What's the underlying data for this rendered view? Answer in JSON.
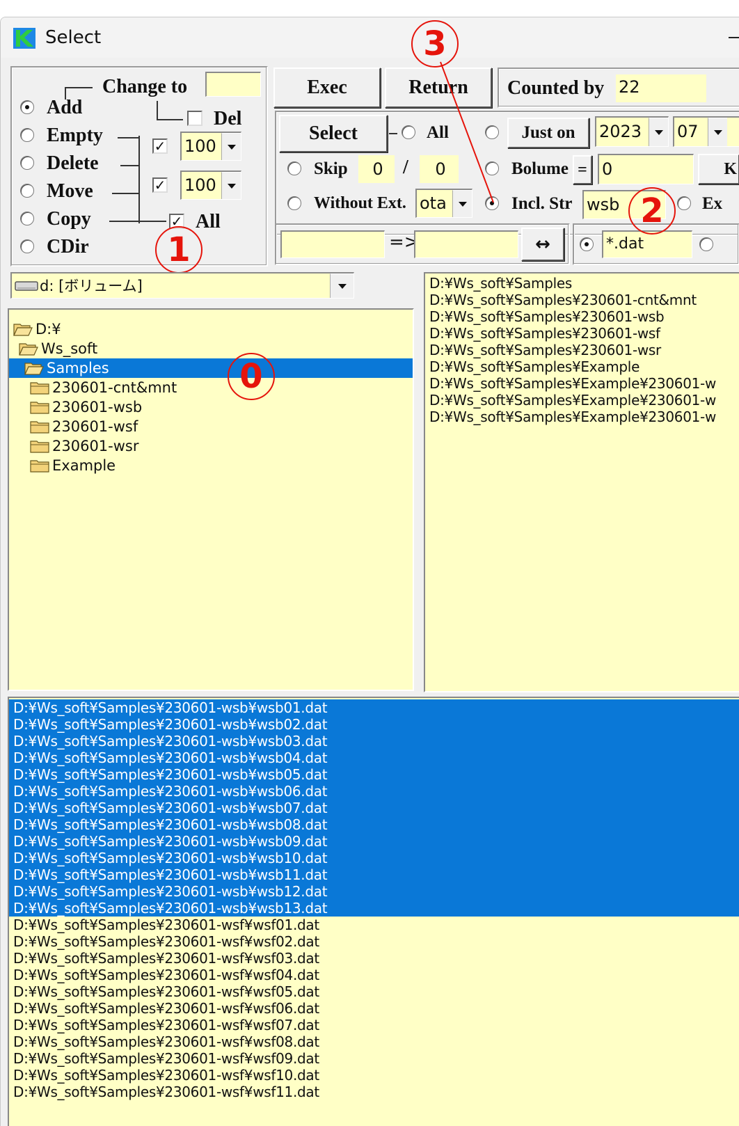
{
  "window": {
    "title": "Select"
  },
  "left_group": {
    "change_to_label": "Change to",
    "change_to_value": "",
    "del_label": "Del",
    "all_label": "All",
    "ops": [
      {
        "label": "Add",
        "selected": true
      },
      {
        "label": "Empty",
        "selected": false
      },
      {
        "label": "Delete",
        "selected": false
      },
      {
        "label": "Move",
        "selected": false
      },
      {
        "label": "Copy",
        "selected": false
      },
      {
        "label": "CDir",
        "selected": false
      }
    ],
    "combo1": "100",
    "combo2": "100"
  },
  "toolbar": {
    "exec_label": "Exec",
    "return_label": "Return",
    "counted_by_label": "Counted by",
    "counted_by_value": "22"
  },
  "select_group": {
    "select_label": "Select",
    "all_label": "All",
    "just_on_label": "Just on",
    "year": "2023",
    "month": "07",
    "skip_label": "Skip",
    "skip_a": "0",
    "skip_sep": "/",
    "skip_b": "0",
    "bolume_label": "Bolume",
    "bolume_op": "=",
    "bolume_value": "0",
    "bolume_unit": "K",
    "without_ext_label": "Without Ext.",
    "without_ext_value": "ota",
    "incl_str_label": "Incl. Str",
    "incl_str_value": "wsb",
    "ex_label": "Ex"
  },
  "rename_row": {
    "from_value": "",
    "arrow_label": "=>",
    "to_value": "",
    "swap_label": "↔",
    "filter_value": "*.dat"
  },
  "drive": {
    "label": "d: [ボリューム]"
  },
  "tree": [
    {
      "label": "D:¥",
      "selected": false
    },
    {
      "label": "Ws_soft",
      "selected": false
    },
    {
      "label": "Samples",
      "selected": true
    },
    {
      "label": "230601-cnt&mnt",
      "selected": false
    },
    {
      "label": "230601-wsb",
      "selected": false
    },
    {
      "label": "230601-wsf",
      "selected": false
    },
    {
      "label": "230601-wsr",
      "selected": false
    },
    {
      "label": "Example",
      "selected": false
    }
  ],
  "dir_list": [
    "D:¥Ws_soft¥Samples",
    "D:¥Ws_soft¥Samples¥230601-cnt&mnt",
    "D:¥Ws_soft¥Samples¥230601-wsb",
    "D:¥Ws_soft¥Samples¥230601-wsf",
    "D:¥Ws_soft¥Samples¥230601-wsr",
    "D:¥Ws_soft¥Samples¥Example",
    "D:¥Ws_soft¥Samples¥Example¥230601-w",
    "D:¥Ws_soft¥Samples¥Example¥230601-w",
    "D:¥Ws_soft¥Samples¥Example¥230601-w"
  ],
  "file_list": [
    {
      "path": "D:¥Ws_soft¥Samples¥230601-wsb¥wsb01.dat",
      "selected": true
    },
    {
      "path": "D:¥Ws_soft¥Samples¥230601-wsb¥wsb02.dat",
      "selected": true
    },
    {
      "path": "D:¥Ws_soft¥Samples¥230601-wsb¥wsb03.dat",
      "selected": true
    },
    {
      "path": "D:¥Ws_soft¥Samples¥230601-wsb¥wsb04.dat",
      "selected": true
    },
    {
      "path": "D:¥Ws_soft¥Samples¥230601-wsb¥wsb05.dat",
      "selected": true
    },
    {
      "path": "D:¥Ws_soft¥Samples¥230601-wsb¥wsb06.dat",
      "selected": true
    },
    {
      "path": "D:¥Ws_soft¥Samples¥230601-wsb¥wsb07.dat",
      "selected": true
    },
    {
      "path": "D:¥Ws_soft¥Samples¥230601-wsb¥wsb08.dat",
      "selected": true
    },
    {
      "path": "D:¥Ws_soft¥Samples¥230601-wsb¥wsb09.dat",
      "selected": true
    },
    {
      "path": "D:¥Ws_soft¥Samples¥230601-wsb¥wsb10.dat",
      "selected": true
    },
    {
      "path": "D:¥Ws_soft¥Samples¥230601-wsb¥wsb11.dat",
      "selected": true
    },
    {
      "path": "D:¥Ws_soft¥Samples¥230601-wsb¥wsb12.dat",
      "selected": true
    },
    {
      "path": "D:¥Ws_soft¥Samples¥230601-wsb¥wsb13.dat",
      "selected": true
    },
    {
      "path": "D:¥Ws_soft¥Samples¥230601-wsf¥wsf01.dat",
      "selected": false
    },
    {
      "path": "D:¥Ws_soft¥Samples¥230601-wsf¥wsf02.dat",
      "selected": false
    },
    {
      "path": "D:¥Ws_soft¥Samples¥230601-wsf¥wsf03.dat",
      "selected": false
    },
    {
      "path": "D:¥Ws_soft¥Samples¥230601-wsf¥wsf04.dat",
      "selected": false
    },
    {
      "path": "D:¥Ws_soft¥Samples¥230601-wsf¥wsf05.dat",
      "selected": false
    },
    {
      "path": "D:¥Ws_soft¥Samples¥230601-wsf¥wsf06.dat",
      "selected": false
    },
    {
      "path": "D:¥Ws_soft¥Samples¥230601-wsf¥wsf07.dat",
      "selected": false
    },
    {
      "path": "D:¥Ws_soft¥Samples¥230601-wsf¥wsf08.dat",
      "selected": false
    },
    {
      "path": "D:¥Ws_soft¥Samples¥230601-wsf¥wsf09.dat",
      "selected": false
    },
    {
      "path": "D:¥Ws_soft¥Samples¥230601-wsf¥wsf10.dat",
      "selected": false
    },
    {
      "path": "D:¥Ws_soft¥Samples¥230601-wsf¥wsf11.dat",
      "selected": false
    }
  ],
  "annotations": [
    "0",
    "1",
    "2",
    "3"
  ],
  "colors": {
    "accent": "#0a78d7",
    "field_bg": "#ffffc6",
    "annotation": "#e5140b"
  }
}
